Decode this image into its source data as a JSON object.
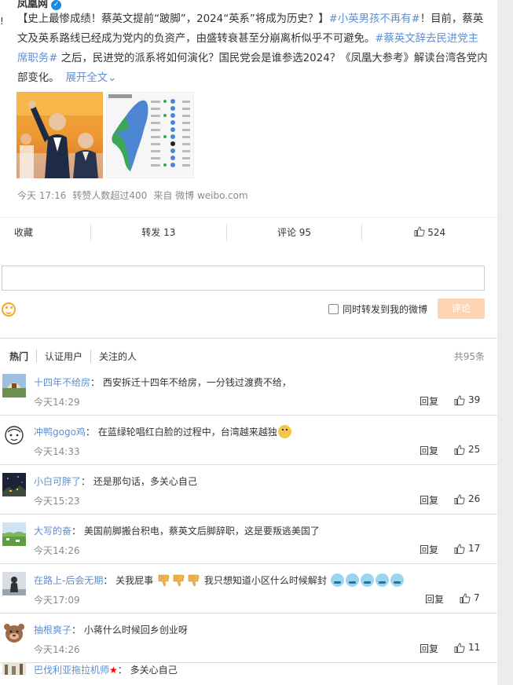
{
  "post": {
    "author": "凤凰网",
    "left_mark": "!",
    "text_main": "【史上最惨成绩！蔡英文提前“跛脚”，2024“英系”将成为历史？】",
    "tag1": "#小英男孩不再有#",
    "text_mid": "！目前，蔡英文及英系路线已经成为党内的负资产，由盛转衰甚至分崩离析似乎不可避免。",
    "tag2": "#蔡英文辞去民进党主席职务#",
    "text_end": " 之后，民进党的派系将如何演化？国民党会是谁参选2024？《凤凰大参考》解读台湾各党内部变化。",
    "expand": "展开全文",
    "time": "今天 17:16",
    "repost_count_text": "转赞人数超过400",
    "source": "来自 微博 weibo.com"
  },
  "actions": {
    "favorite": "收藏",
    "repost": "转发 13",
    "comment": "评论 95",
    "like": "524"
  },
  "compose": {
    "repost_label": "同时转发到我的微博",
    "submit": "评论"
  },
  "filters": {
    "hot": "热门",
    "verified": "认证用户",
    "following": "关注的人",
    "total": "共95条"
  },
  "comments": [
    {
      "user": "十四年不给房",
      "text": "西安拆迁十四年不给房，一分钱过渡费不给，",
      "time": "今天14:29",
      "reply": "回复",
      "likes": "39"
    },
    {
      "user": "冲鸭gogo鸡",
      "text": "在蓝绿轮唱红白脸的过程中，台湾越来越独",
      "time": "今天14:33",
      "reply": "回复",
      "likes": "25"
    },
    {
      "user": "小白可胖了",
      "text": "还是那句话，多关心自己",
      "time": "今天15:23",
      "reply": "回复",
      "likes": "26"
    },
    {
      "user": "大写的奋",
      "text": "美国前脚搬台积电，蔡英文后脚辞职，这是要叛逃美国了",
      "time": "今天14:26",
      "reply": "回复",
      "likes": "17"
    },
    {
      "user": "在路上-后会无期",
      "text_a": "关我屁事",
      "text_b": "我只想知道小区什么时候解封",
      "time": "今天17:09",
      "reply": "回复",
      "likes": "7"
    },
    {
      "user": "抽根爽子",
      "text": "小蒋什么时候回乡创业呀",
      "time": "今天14:26",
      "reply": "回复",
      "likes": "11"
    },
    {
      "user": "巴伐利亚拖拉机师",
      "text": "多关心自己"
    }
  ]
}
